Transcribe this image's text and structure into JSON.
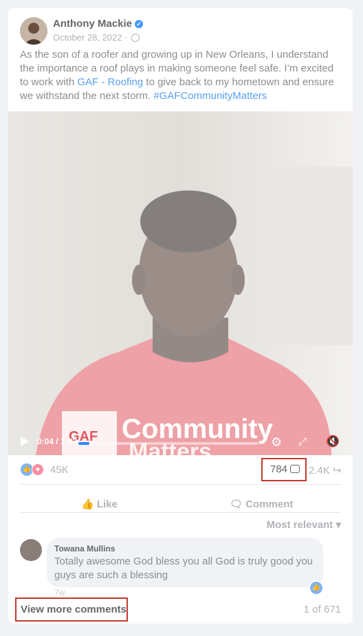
{
  "post": {
    "author": "Anthony Mackie",
    "date": "October 28, 2022 ·",
    "text_1": "As the son of a roofer and growing up in New Orleans, I understand the importance a roof plays in making someone feel safe. I’m excited to work with ",
    "link_1": "GAF - Roofing",
    "text_2": " to give back to my hometown and ensure we withstand the next storm. ",
    "hashtag": "#GAFCommunityMatters"
  },
  "video": {
    "time": "0:04 / 1:03",
    "progress": 0.06,
    "shirt_line_1": "Community",
    "shirt_line_2": "Matters",
    "logo": "GAF"
  },
  "stats": {
    "reactions": "45K",
    "comments": "784",
    "shares": "2.4K"
  },
  "actions": {
    "like": "Like",
    "comment": "Comment"
  },
  "comments": {
    "sort": "Most relevant",
    "items": [
      {
        "name": "Towana Mullins",
        "text": "Totally awesome God bless you all God is truly good you guys are such a blessing",
        "time": "7w"
      }
    ],
    "view_more": "View more comments",
    "pager": "1 of 671"
  },
  "colors": {
    "accent": "#2d88ff",
    "highlight_box": "#c0392b",
    "shirt": "#e0545e"
  }
}
